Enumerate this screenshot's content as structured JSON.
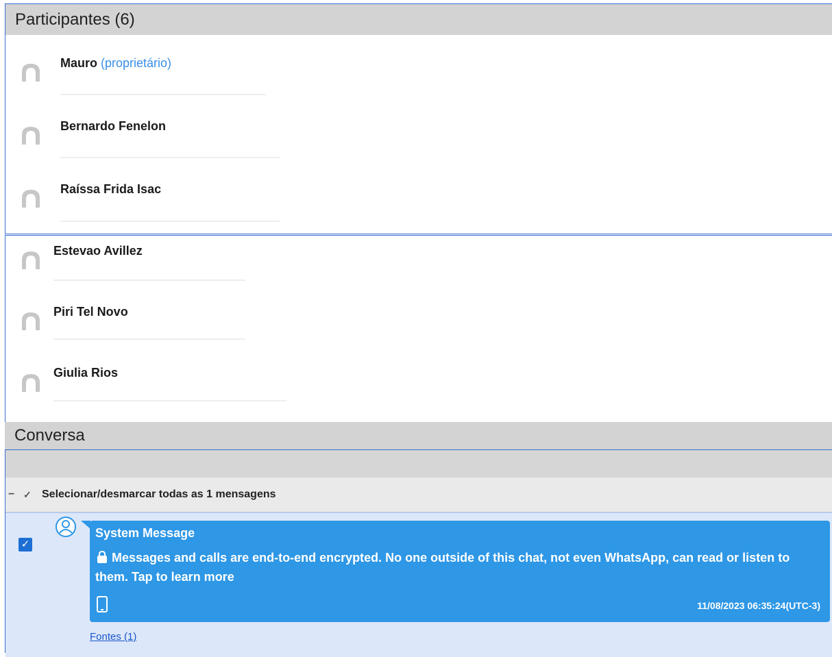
{
  "participants_section": {
    "title": "Participantes (6)",
    "list": [
      {
        "name": "Mauro",
        "role": "(proprietário)"
      },
      {
        "name": "Bernardo Fenelon",
        "role": ""
      },
      {
        "name": "Raíssa Frida Isac",
        "role": ""
      },
      {
        "name": "Estevao Avillez",
        "role": ""
      },
      {
        "name": "Piri Tel Novo",
        "role": ""
      },
      {
        "name": "Giulia Rios",
        "role": ""
      }
    ]
  },
  "conversation_section": {
    "title": "Conversa",
    "select_all_label": "Selecionar/desmarcar todas as 1 mensagens",
    "message": {
      "sender": "System Message",
      "text": "Messages and calls are end-to-end encrypted. No one outside of this chat, not even WhatsApp, can read or listen to them. Tap to learn more",
      "timestamp": "11/08/2023 06:35:24(UTC-3)",
      "checked": true,
      "sources_link": "Fontes (1)"
    }
  },
  "colors": {
    "bubble": "#2e97e6",
    "checkbox": "#1e6fd3",
    "owner_label": "#3a8ee6",
    "link": "#1a56c8",
    "frame_border": "#3a6fd0"
  },
  "icons": {
    "avatar": "person-silhouette-icon",
    "system_sender": "user-circle-icon",
    "lock": "lock-icon",
    "device": "smartphone-icon",
    "collapse": "minus-icon",
    "check": "checkmark-icon"
  }
}
